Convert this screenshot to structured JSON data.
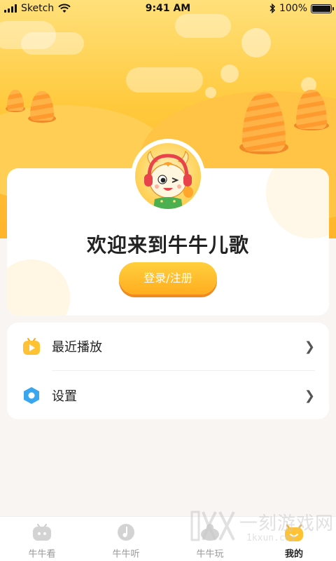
{
  "status_bar": {
    "carrier": "Sketch",
    "time": "9:41 AM",
    "battery": "100%"
  },
  "profile": {
    "welcome_text": "欢迎来到牛牛儿歌",
    "login_label": "登录/注册"
  },
  "menu": {
    "items": [
      {
        "label": "最近播放",
        "icon": "play-tv-icon"
      },
      {
        "label": "设置",
        "icon": "settings-hexagon-icon"
      }
    ]
  },
  "tabs": [
    {
      "label": "牛牛看",
      "icon": "tv-icon",
      "active": false
    },
    {
      "label": "牛牛听",
      "icon": "music-icon",
      "active": false
    },
    {
      "label": "牛牛玩",
      "icon": "game-icon",
      "active": false
    },
    {
      "label": "我的",
      "icon": "mine-icon",
      "active": true
    }
  ],
  "colors": {
    "accent": "#ffb42a",
    "button": "#ffad1f",
    "background": "#f8f5f2"
  },
  "watermark": {
    "text": "一刻游戏网",
    "domain": "1kxun.com"
  }
}
